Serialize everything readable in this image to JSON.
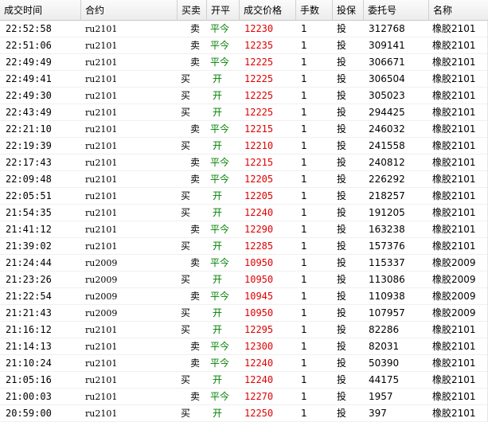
{
  "columns": [
    "成交时间",
    "合约",
    "买卖",
    "开平",
    "成交价格",
    "手数",
    "投保",
    "委托号",
    "名称"
  ],
  "rows": [
    [
      "22:52:58",
      "ru2101",
      "卖",
      "平今",
      "12230",
      "1",
      "投",
      "312768",
      "橡胶2101"
    ],
    [
      "22:51:06",
      "ru2101",
      "卖",
      "平今",
      "12235",
      "1",
      "投",
      "309141",
      "橡胶2101"
    ],
    [
      "22:49:49",
      "ru2101",
      "卖",
      "平今",
      "12225",
      "1",
      "投",
      "306671",
      "橡胶2101"
    ],
    [
      "22:49:41",
      "ru2101",
      "买",
      "开",
      "12225",
      "1",
      "投",
      "306504",
      "橡胶2101"
    ],
    [
      "22:49:30",
      "ru2101",
      "买",
      "开",
      "12225",
      "1",
      "投",
      "305023",
      "橡胶2101"
    ],
    [
      "22:43:49",
      "ru2101",
      "买",
      "开",
      "12225",
      "1",
      "投",
      "294425",
      "橡胶2101"
    ],
    [
      "22:21:10",
      "ru2101",
      "卖",
      "平今",
      "12215",
      "1",
      "投",
      "246032",
      "橡胶2101"
    ],
    [
      "22:19:39",
      "ru2101",
      "买",
      "开",
      "12210",
      "1",
      "投",
      "241558",
      "橡胶2101"
    ],
    [
      "22:17:43",
      "ru2101",
      "卖",
      "平今",
      "12215",
      "1",
      "投",
      "240812",
      "橡胶2101"
    ],
    [
      "22:09:48",
      "ru2101",
      "卖",
      "平今",
      "12205",
      "1",
      "投",
      "226292",
      "橡胶2101"
    ],
    [
      "22:05:51",
      "ru2101",
      "买",
      "开",
      "12205",
      "1",
      "投",
      "218257",
      "橡胶2101"
    ],
    [
      "21:54:35",
      "ru2101",
      "买",
      "开",
      "12240",
      "1",
      "投",
      "191205",
      "橡胶2101"
    ],
    [
      "21:41:12",
      "ru2101",
      "卖",
      "平今",
      "12290",
      "1",
      "投",
      "163238",
      "橡胶2101"
    ],
    [
      "21:39:02",
      "ru2101",
      "买",
      "开",
      "12285",
      "1",
      "投",
      "157376",
      "橡胶2101"
    ],
    [
      "21:24:44",
      "ru2009",
      "卖",
      "平今",
      "10950",
      "1",
      "投",
      "115337",
      "橡胶2009"
    ],
    [
      "21:23:26",
      "ru2009",
      "买",
      "开",
      "10950",
      "1",
      "投",
      "113086",
      "橡胶2009"
    ],
    [
      "21:22:54",
      "ru2009",
      "卖",
      "平今",
      "10945",
      "1",
      "投",
      "110938",
      "橡胶2009"
    ],
    [
      "21:21:43",
      "ru2009",
      "买",
      "开",
      "10950",
      "1",
      "投",
      "107957",
      "橡胶2009"
    ],
    [
      "21:16:12",
      "ru2101",
      "买",
      "开",
      "12295",
      "1",
      "投",
      "82286",
      "橡胶2101"
    ],
    [
      "21:14:13",
      "ru2101",
      "卖",
      "平今",
      "12300",
      "1",
      "投",
      "82031",
      "橡胶2101"
    ],
    [
      "21:10:24",
      "ru2101",
      "卖",
      "平今",
      "12240",
      "1",
      "投",
      "50390",
      "橡胶2101"
    ],
    [
      "21:05:16",
      "ru2101",
      "买",
      "开",
      "12240",
      "1",
      "投",
      "44175",
      "橡胶2101"
    ],
    [
      "21:00:03",
      "ru2101",
      "卖",
      "平今",
      "12270",
      "1",
      "投",
      "1957",
      "橡胶2101"
    ],
    [
      "20:59:00",
      "ru2101",
      "买",
      "开",
      "12250",
      "1",
      "投",
      "397",
      "橡胶2101"
    ]
  ],
  "colors": {
    "price": "#e00000",
    "open_close": "#008000"
  }
}
